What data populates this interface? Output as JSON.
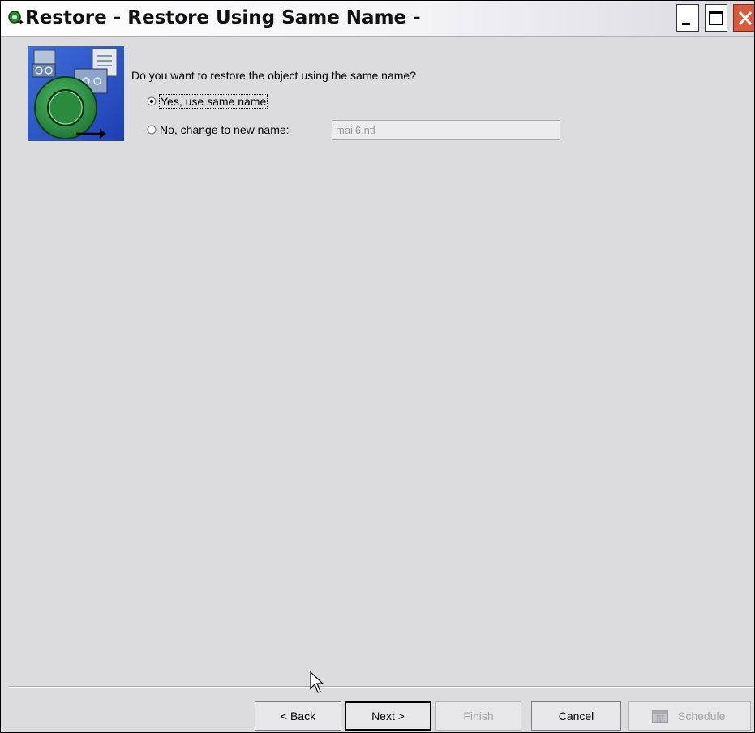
{
  "window": {
    "title": "Restore - Restore Using Same Name -"
  },
  "icons": {
    "title_icon": "restore-app-icon",
    "wizard_image": "tape-restore-illustration",
    "minimize": "minimize-icon",
    "maximize": "maximize-icon",
    "close": "close-icon",
    "schedule": "calendar-icon",
    "cursor": "mouse-pointer-icon"
  },
  "content": {
    "question": "Do you want to restore the object using the same name?",
    "options": [
      {
        "label": "Yes, use same name",
        "selected": true
      },
      {
        "label": "No, change to new name:",
        "selected": false
      }
    ],
    "new_name_value": "mail6.ntf"
  },
  "buttons": {
    "back": "< Back",
    "next": "Next >",
    "finish": "Finish",
    "cancel": "Cancel",
    "schedule": "Schedule"
  },
  "colors": {
    "window_bg": "#dcdcdf",
    "close_button": "#d95a3a",
    "disabled_text": "#a4a4a8"
  }
}
